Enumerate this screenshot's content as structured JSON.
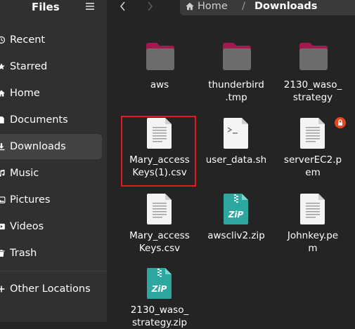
{
  "window": {
    "title": "Files"
  },
  "sidebar": {
    "items": [
      {
        "label": "Recent",
        "icon": "clock-icon",
        "active": false
      },
      {
        "label": "Starred",
        "icon": "star-icon",
        "active": false
      },
      {
        "label": "Home",
        "icon": "home-icon",
        "active": false
      },
      {
        "label": "Documents",
        "icon": "document-icon",
        "active": false
      },
      {
        "label": "Downloads",
        "icon": "download-icon",
        "active": true
      },
      {
        "label": "Music",
        "icon": "music-icon",
        "active": false
      },
      {
        "label": "Pictures",
        "icon": "picture-icon",
        "active": false
      },
      {
        "label": "Videos",
        "icon": "video-icon",
        "active": false
      },
      {
        "label": "Trash",
        "icon": "trash-icon",
        "active": false
      },
      {
        "label": "Other Locations",
        "icon": "plus-icon",
        "active": false
      }
    ]
  },
  "pathbar": {
    "home": "Home",
    "separator": "/",
    "current": "Downloads"
  },
  "files": [
    {
      "name": "aws",
      "type": "folder"
    },
    {
      "name": "thunderbird\n.tmp",
      "type": "folder"
    },
    {
      "name": "2130_waso_\nstrategy",
      "type": "folder"
    },
    {
      "name": "Mary_access\nKeys(1).csv",
      "type": "text",
      "selected": true
    },
    {
      "name": "user_data.sh",
      "type": "script"
    },
    {
      "name": "serverEC2.p\nem",
      "type": "text",
      "locked": true
    },
    {
      "name": "Mary_access\nKeys.csv",
      "type": "text"
    },
    {
      "name": "awscliv2.zip",
      "type": "zip"
    },
    {
      "name": "Johnkey.pe\nm",
      "type": "text"
    },
    {
      "name": "2130_waso_\nstrategy.zip",
      "type": "zip"
    }
  ],
  "colors": {
    "selection_border": "#e01b24",
    "folder_tab": "#a1194f",
    "zip_badge": "#2ea7a1",
    "lock_badge": "#e5471e"
  }
}
